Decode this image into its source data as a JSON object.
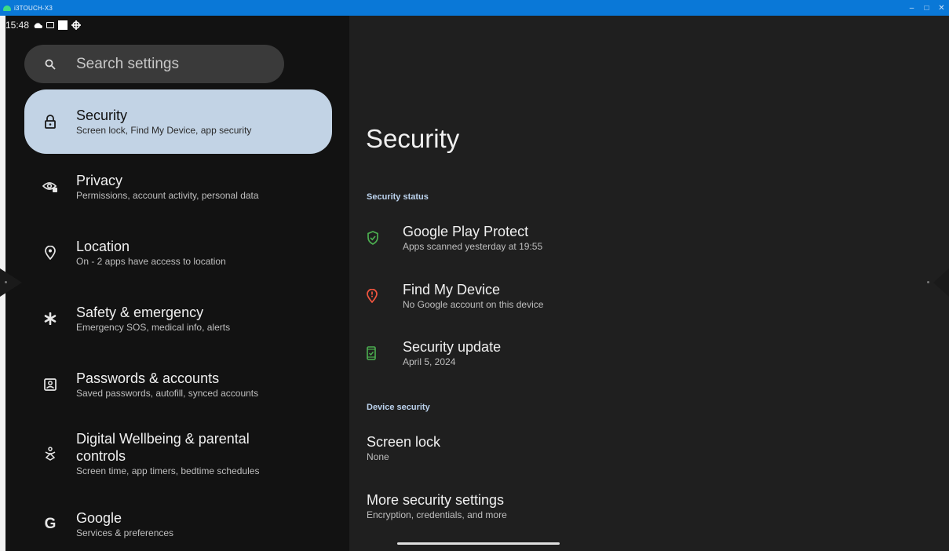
{
  "window": {
    "title": "i3TOUCH-X3",
    "controls": {
      "minimize": "–",
      "maximize": "□",
      "close": "✕"
    }
  },
  "statusbar": {
    "time": "15:48"
  },
  "search": {
    "placeholder": "Search settings"
  },
  "sidebar": {
    "items": [
      {
        "title": "Security",
        "subtitle": "Screen lock, Find My Device, app security",
        "icon": "lock-icon",
        "active": true
      },
      {
        "title": "Privacy",
        "subtitle": "Permissions, account activity, personal data",
        "icon": "privacy-eye-icon"
      },
      {
        "title": "Location",
        "subtitle": "On - 2 apps have access to location",
        "icon": "location-pin-icon"
      },
      {
        "title": "Safety & emergency",
        "subtitle": "Emergency SOS, medical info, alerts",
        "icon": "asterisk-icon"
      },
      {
        "title": "Passwords & accounts",
        "subtitle": "Saved passwords, autofill, synced accounts",
        "icon": "account-box-icon"
      },
      {
        "title": "Digital Wellbeing & parental controls",
        "subtitle": "Screen time, app timers, bedtime schedules",
        "icon": "wellbeing-icon"
      },
      {
        "title": "Google",
        "subtitle": "Services & preferences",
        "icon": "google-g-icon"
      }
    ]
  },
  "main": {
    "title": "Security",
    "security_status_label": "Security status",
    "status_items": [
      {
        "title": "Google Play Protect",
        "subtitle": "Apps scanned yesterday at 19:55",
        "icon": "shield-check-icon",
        "color": "#4caf50"
      },
      {
        "title": "Find My Device",
        "subtitle": "No Google account on this device",
        "icon": "location-alert-icon",
        "color": "#f2553f"
      },
      {
        "title": "Security update",
        "subtitle": "April 5, 2024",
        "icon": "phone-check-icon",
        "color": "#4caf50"
      }
    ],
    "device_security_label": "Device security",
    "device_items": [
      {
        "title": "Screen lock",
        "subtitle": "None"
      },
      {
        "title": "More security settings",
        "subtitle": "Encryption, credentials, and more"
      }
    ]
  },
  "colors": {
    "accent_active": "#c2d3e5",
    "section_label": "#bcd3ee",
    "titlebar": "#0a78d7"
  }
}
